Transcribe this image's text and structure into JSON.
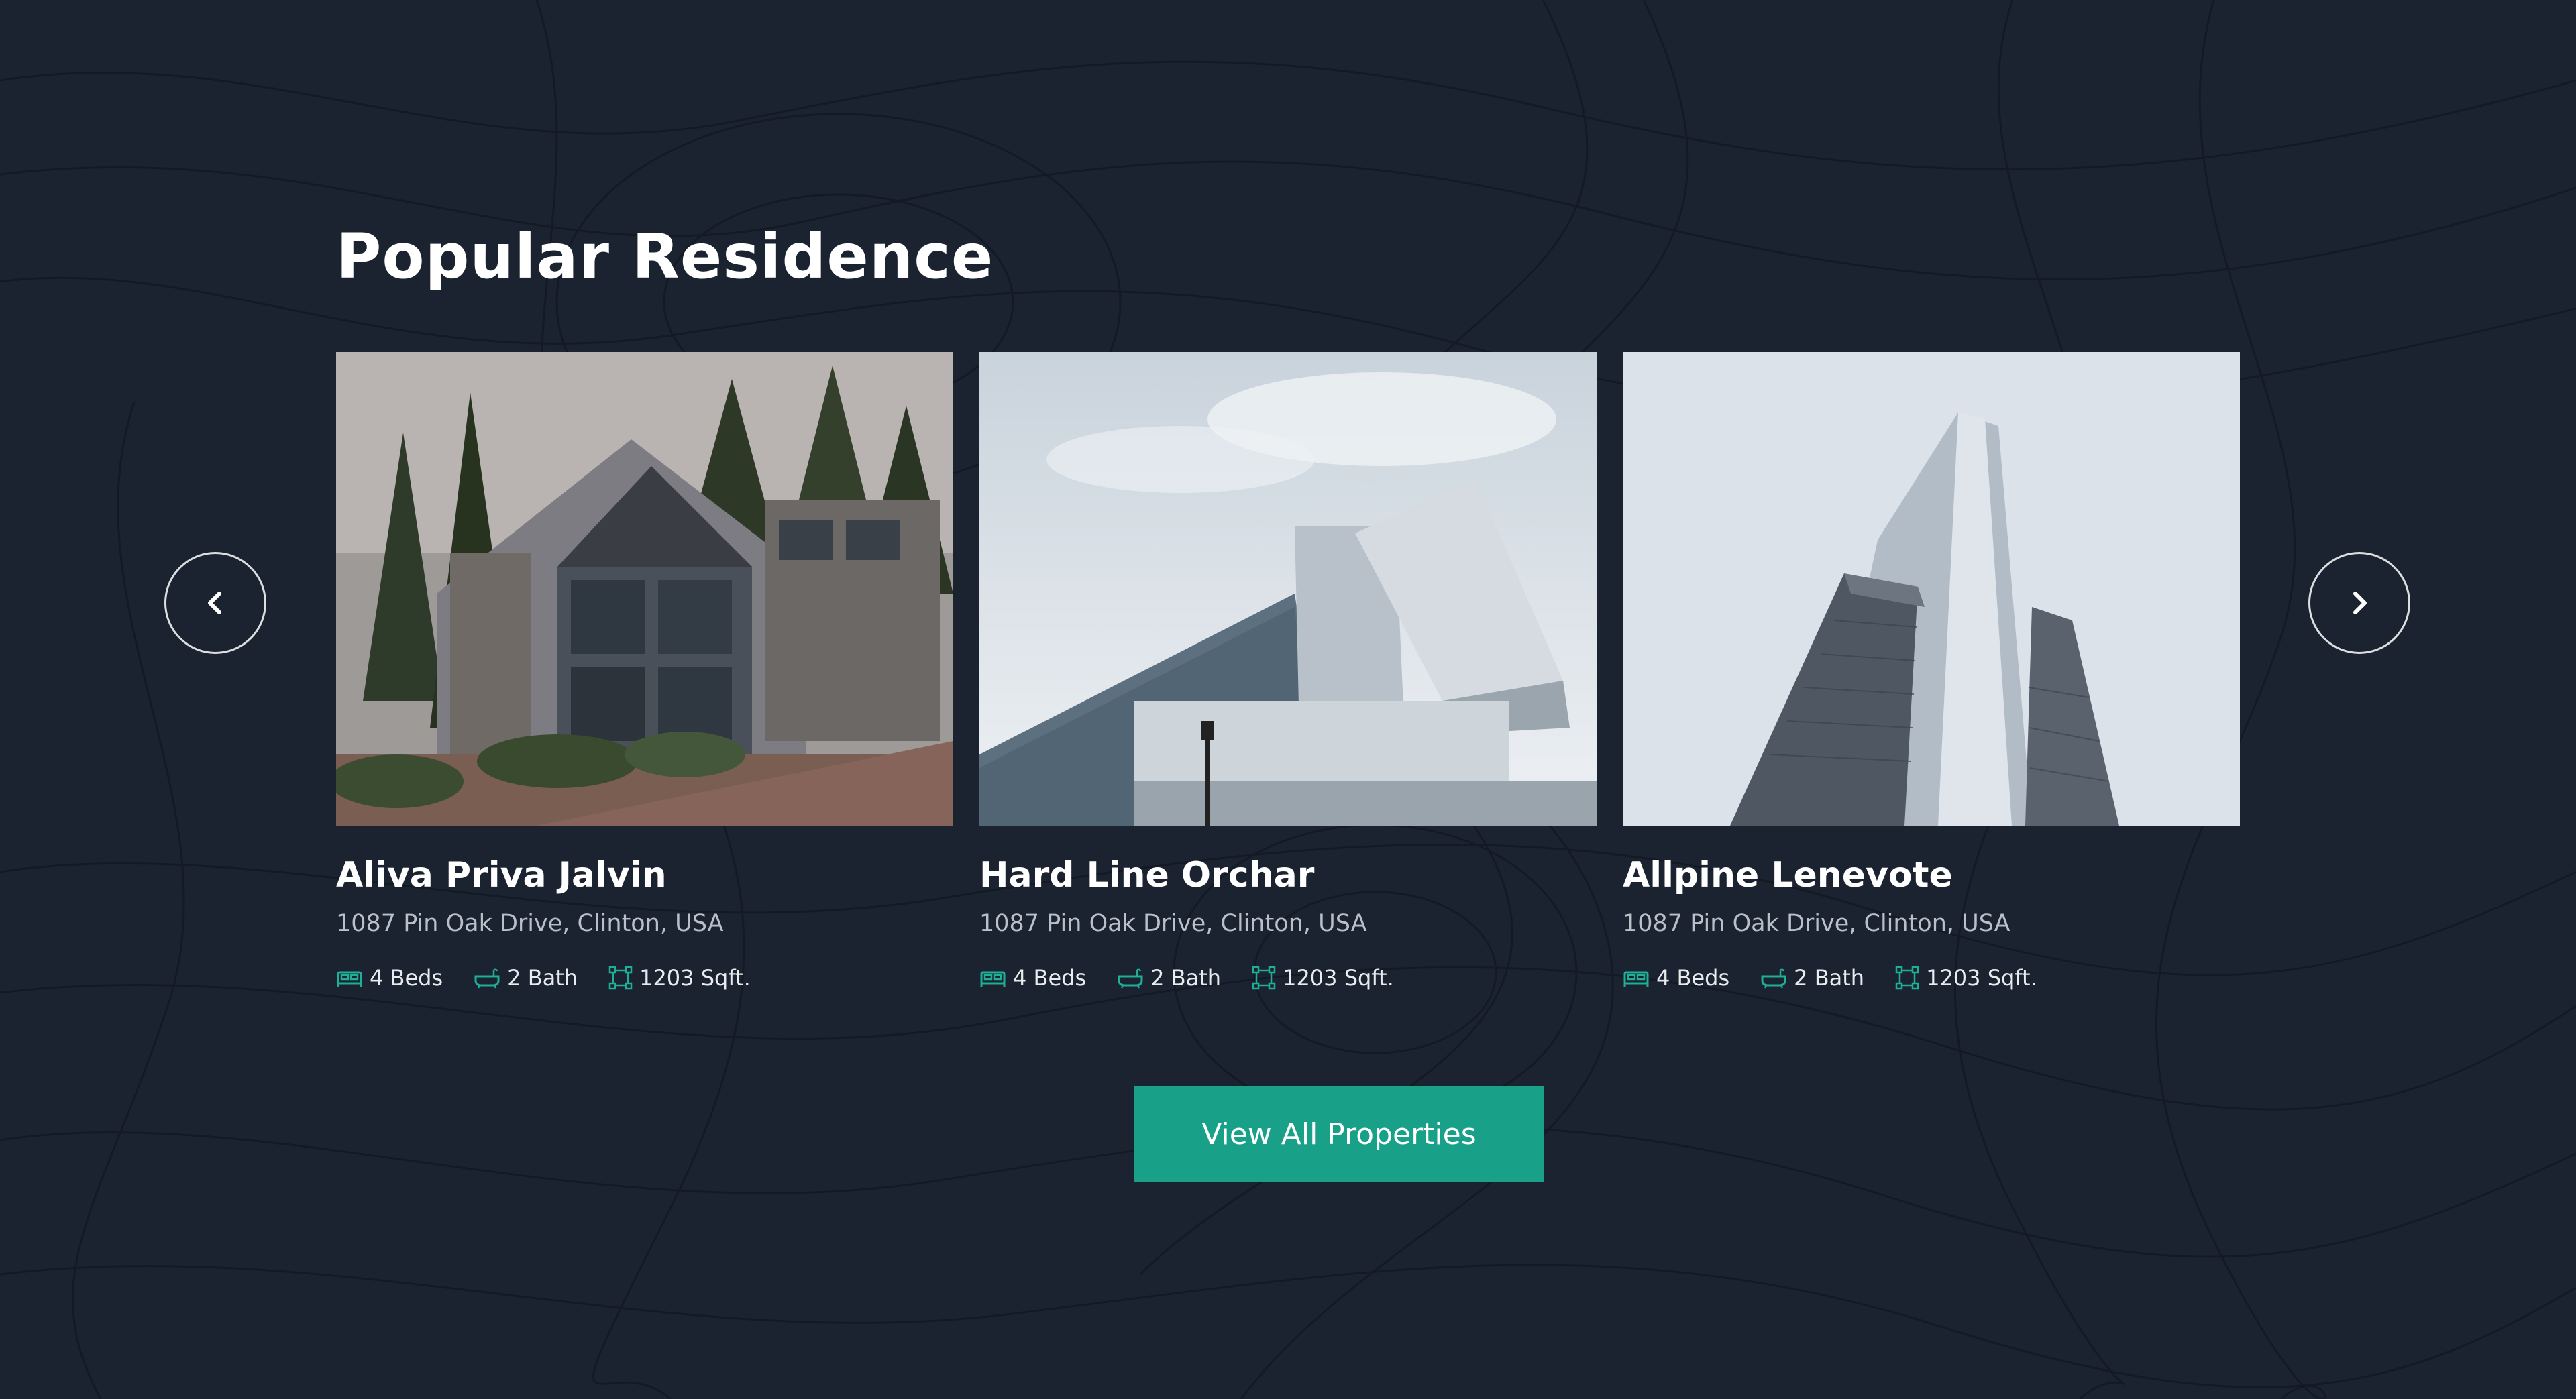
{
  "section": {
    "title": "Popular Residence"
  },
  "carousel": {
    "prev_icon": "chevron-left-icon",
    "next_icon": "chevron-right-icon"
  },
  "properties": [
    {
      "name": "Aliva Priva Jalvin",
      "address": "1087 Pin Oak Drive, Clinton, USA",
      "beds": "4 Beds",
      "bath": "2 Bath",
      "area": "1203 Sqft.",
      "image": "house-photo"
    },
    {
      "name": "Hard Line Orchar",
      "address": "1087 Pin Oak Drive, Clinton, USA",
      "beds": "4 Beds",
      "bath": "2 Bath",
      "area": "1203 Sqft.",
      "image": "modern-building-photo"
    },
    {
      "name": "Allpine Lenevote",
      "address": "1087 Pin Oak Drive, Clinton, USA",
      "beds": "4 Beds",
      "bath": "2 Bath",
      "area": "1203 Sqft.",
      "image": "skyscraper-photo"
    }
  ],
  "cta": {
    "label": "View All Properties"
  },
  "colors": {
    "background": "#1b2330",
    "accent": "#19a089",
    "text": "#ffffff",
    "muted_text": "#b9c0c9"
  }
}
